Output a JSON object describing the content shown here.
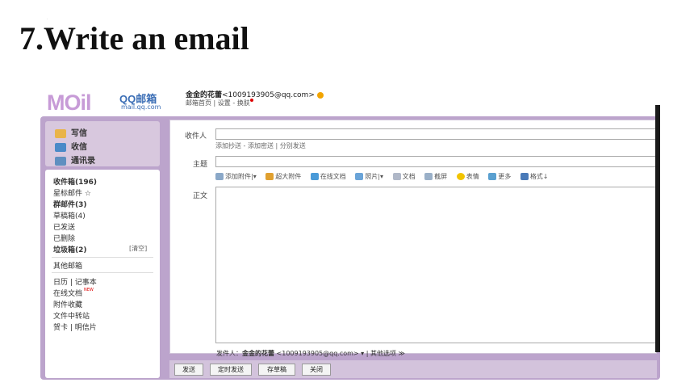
{
  "slide": {
    "title": "7.Write an email",
    "dot": "."
  },
  "header": {
    "logo_mail": "MOil",
    "logo_qq": "QQ邮箱",
    "logo_domain": "mail.qq.com",
    "account_name": "金金的花蕾",
    "account_email": "<1009193905@qq.com>",
    "links": "邮箱首页 | 设置 - 换肤"
  },
  "sidebar": {
    "write": "写信",
    "receive": "收信",
    "contacts": "通讯录",
    "folders": [
      "收件箱(196)",
      "星标邮件 ☆",
      "群邮件(3)",
      "草稿箱(4)",
      "已发送",
      "已删除",
      "垃圾箱(2)"
    ],
    "clear": "[清空]",
    "other_mailbox": "其他邮箱",
    "tools": [
      "日历 | 记事本",
      "在线文档",
      "附件收藏",
      "文件中转站",
      "贺卡 | 明信片"
    ],
    "new_tag": "NEW"
  },
  "compose": {
    "to_label": "收件人",
    "to_value": "",
    "to_links": "添加抄送 - 添加密送 | 分别发送",
    "subject_label": "主题",
    "subject_value": "",
    "body_label": "正文",
    "body_value": "",
    "toolbar": [
      "添加附件|▾",
      "超大附件",
      "在线文档",
      "照片|▾",
      "文档",
      "截屏",
      "表情",
      "更多",
      "格式↓"
    ],
    "sender_label": "发件人：",
    "sender_name": "金金的花蕾",
    "sender_email": "<1009193905@qq.com> ▾  |  其他选项 ≫"
  },
  "buttons": {
    "send": "发送",
    "timed_send": "定时发送",
    "save_draft": "存草稿",
    "close": "关闭"
  },
  "colors": {
    "frame": "#bca4cc",
    "logo": "#c79bd7",
    "link": "#3a6db5"
  }
}
